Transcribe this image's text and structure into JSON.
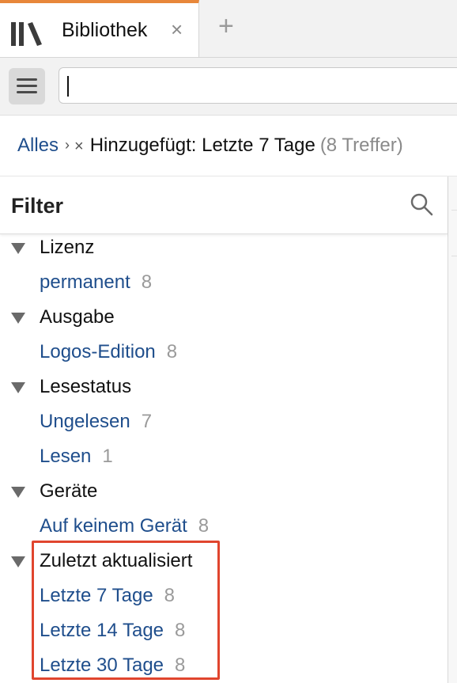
{
  "tab": {
    "title": "Bibliothek",
    "close_symbol": "×",
    "new_tab_symbol": "+"
  },
  "search": {
    "value": "",
    "placeholder": ""
  },
  "breadcrumb": {
    "root": "Alles",
    "separator": "›",
    "remove_symbol": "×",
    "filter": "Hinzugefügt: Letzte 7 Tage",
    "count": "(8 Treffer)"
  },
  "filter_panel": {
    "title": "Filter",
    "groups": [
      {
        "label": "Lizenz",
        "items": [
          {
            "label": "permanent",
            "count": "8"
          }
        ]
      },
      {
        "label": "Ausgabe",
        "items": [
          {
            "label": "Logos-Edition",
            "count": "8"
          }
        ]
      },
      {
        "label": "Lesestatus",
        "items": [
          {
            "label": "Ungelesen",
            "count": "7"
          },
          {
            "label": "Lesen",
            "count": "1"
          }
        ]
      },
      {
        "label": "Geräte",
        "items": [
          {
            "label": "Auf keinem Gerät",
            "count": "8"
          }
        ]
      },
      {
        "label": "Zuletzt aktualisiert",
        "items": [
          {
            "label": "Letzte 7 Tage",
            "count": "8"
          },
          {
            "label": "Letzte 14 Tage",
            "count": "8"
          },
          {
            "label": "Letzte 30 Tage",
            "count": "8"
          }
        ]
      }
    ]
  },
  "colors": {
    "accent_tab": "#e8873a",
    "link": "#1f4e8c",
    "highlight": "#e0452e"
  },
  "icons": [
    "library-icon",
    "close-icon",
    "plus-icon",
    "hamburger-icon",
    "search-icon",
    "collapse-triangle-icon"
  ]
}
